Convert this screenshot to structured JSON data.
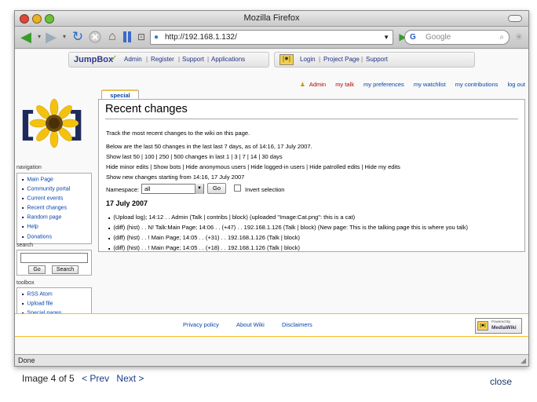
{
  "browser": {
    "title": "Mozilla Firefox",
    "url": "http://192.168.1.132/",
    "search_placeholder": "Google",
    "status": "Done"
  },
  "jumpbox": {
    "logo": "JumpBox",
    "left_links": [
      "Admin",
      "Register",
      "Support",
      "Applications"
    ],
    "right_links": [
      "Login",
      "Project Page",
      "Support"
    ]
  },
  "personal": [
    "Admin",
    "my talk",
    "my preferences",
    "my watchlist",
    "my contributions",
    "log out"
  ],
  "tab": "special",
  "page": {
    "title": "Recent changes",
    "intro": "Track the most recent changes to the wiki on this page.",
    "line1": "Below are the last 50 changes in the last last 7 days, as of 14:16, 17 July 2007.",
    "line2": "Show last 50 | 100 | 250 | 500 changes in last 1 | 3 | 7 | 14 | 30 days",
    "line3": "Hide minor edits | Show bots | Hide anonymous users | Hide logged-in users | Hide patrolled edits | Hide my edits",
    "line4": "Show new changes starting from 14:16, 17 July 2007",
    "namespace_label": "Namespace:",
    "namespace_value": "all",
    "go": "Go",
    "invert": "Invert selection",
    "date": "17 July 2007",
    "changes": [
      "(Upload log); 14:12 . . Admin (Talk | contribs | block) (uploaded \"Image:Cat.png\": this is a cat)",
      "(diff) (hist) . . N! Talk:Main Page; 14:06 . . (+47) . . 192.168.1.126 (Talk | block) (New page: This is the talking page this is where you talk)",
      "(diff) (hist) . . ! Main Page; 14:05 . . (+31) . . 192.168.1.126 (Talk | block)",
      "(diff) (hist) . . ! Main Page; 14:05 . . (+18) . . 192.168.1.126 (Talk | block)"
    ]
  },
  "sidebar": {
    "navigation_title": "navigation",
    "navigation": [
      "Main Page",
      "Community portal",
      "Current events",
      "Recent changes",
      "Random page",
      "Help",
      "Donations"
    ],
    "search_title": "search",
    "search_go": "Go",
    "search_btn": "Search",
    "toolbox_title": "toolbox",
    "toolbox": [
      "RSS  Atom",
      "Upload file",
      "Special pages"
    ]
  },
  "footer": {
    "links": [
      "Privacy policy",
      "About Wiki",
      "Disclaimers"
    ],
    "badge_top": "Powered By",
    "badge": "MediaWiki"
  },
  "gallery": {
    "counter": "Image 4 of 5",
    "prev": "< Prev",
    "next": "Next >",
    "close": "close"
  }
}
